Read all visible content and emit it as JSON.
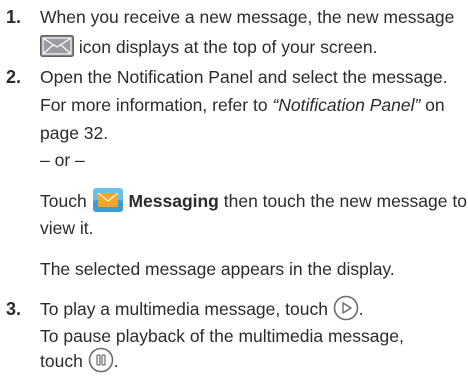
{
  "steps": [
    {
      "number": "1.",
      "lines": [
        "When you receive a new message, the new message",
        "icon displays at the top of your screen."
      ],
      "icon": "new-message-envelope-icon"
    },
    {
      "number": "2.",
      "line1": "Open the Notification Panel and select the message.",
      "line2_prefix": "For more information, refer to ",
      "line2_ref": "“Notification Panel”",
      "line2_suffix": " on",
      "line3": "page 32.",
      "or_text": "– or –",
      "touch_word": "Touch ",
      "messaging_icon": "messaging-app-icon",
      "messaging_label": "Messaging",
      "touch_suffix": " then touch the new message to",
      "view_line": "view it.",
      "result_line": "The selected message appears in the display."
    },
    {
      "number": "3.",
      "line1": "To play a multimedia message, touch",
      "play_icon": "play-button-icon",
      "line1_end": ".",
      "line2": "To pause playback of the multimedia message,",
      "line3": "touch",
      "pause_icon": "pause-button-icon",
      "line3_end": "."
    }
  ]
}
